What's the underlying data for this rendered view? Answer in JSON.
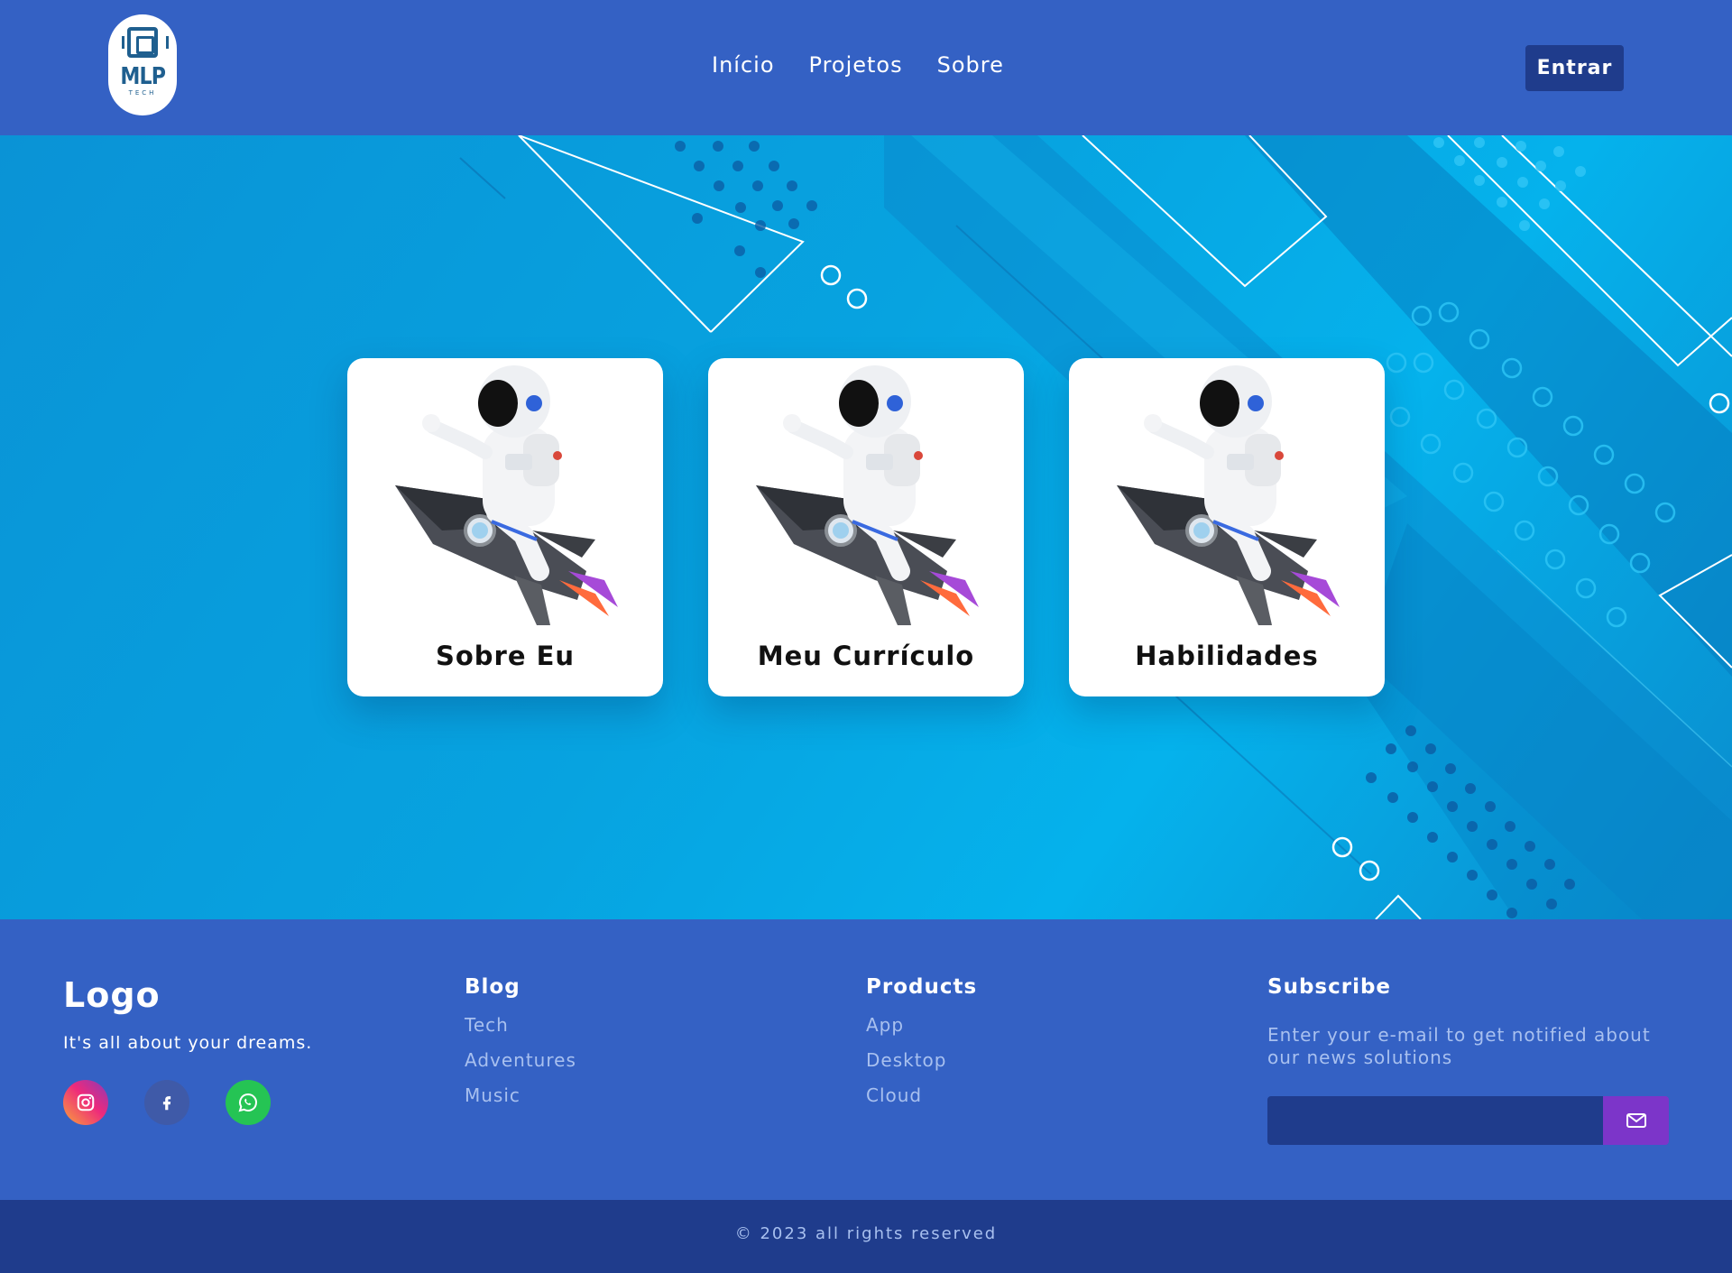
{
  "header": {
    "logo_text": "MLP",
    "logo_sub": "TECH",
    "nav": [
      {
        "label": "Início"
      },
      {
        "label": "Projetos"
      },
      {
        "label": "Sobre"
      }
    ],
    "login_label": "Entrar"
  },
  "cards": [
    {
      "title": "Sobre Eu",
      "icon": "astronaut-rocket-illustration"
    },
    {
      "title": "Meu Currículo",
      "icon": "astronaut-rocket-illustration"
    },
    {
      "title": "Habilidades",
      "icon": "astronaut-rocket-illustration"
    }
  ],
  "footer": {
    "brand": {
      "logo": "Logo",
      "tagline": "It's all about your dreams.",
      "socials": [
        {
          "icon": "instagram-icon",
          "color": "#ee2a7b"
        },
        {
          "icon": "facebook-icon",
          "color": "#3f5aa8"
        },
        {
          "icon": "whatsapp-icon",
          "color": "#25c454"
        }
      ]
    },
    "blog": {
      "title": "Blog",
      "links": [
        "Tech",
        "Adventures",
        "Music"
      ]
    },
    "products": {
      "title": "Products",
      "links": [
        "App",
        "Desktop",
        "Cloud"
      ]
    },
    "subscribe": {
      "title": "Subscribe",
      "description": "Enter your e-mail to get notified about our news solutions",
      "placeholder": "",
      "button_icon": "envelope-icon"
    },
    "copyright": "© 2023 all rights reserved"
  },
  "colors": {
    "header_bg": "#3461c4",
    "dark_blue": "#1f3c8c",
    "accent_purple": "#7c35c9",
    "hero_blue": "#07a3e0"
  }
}
